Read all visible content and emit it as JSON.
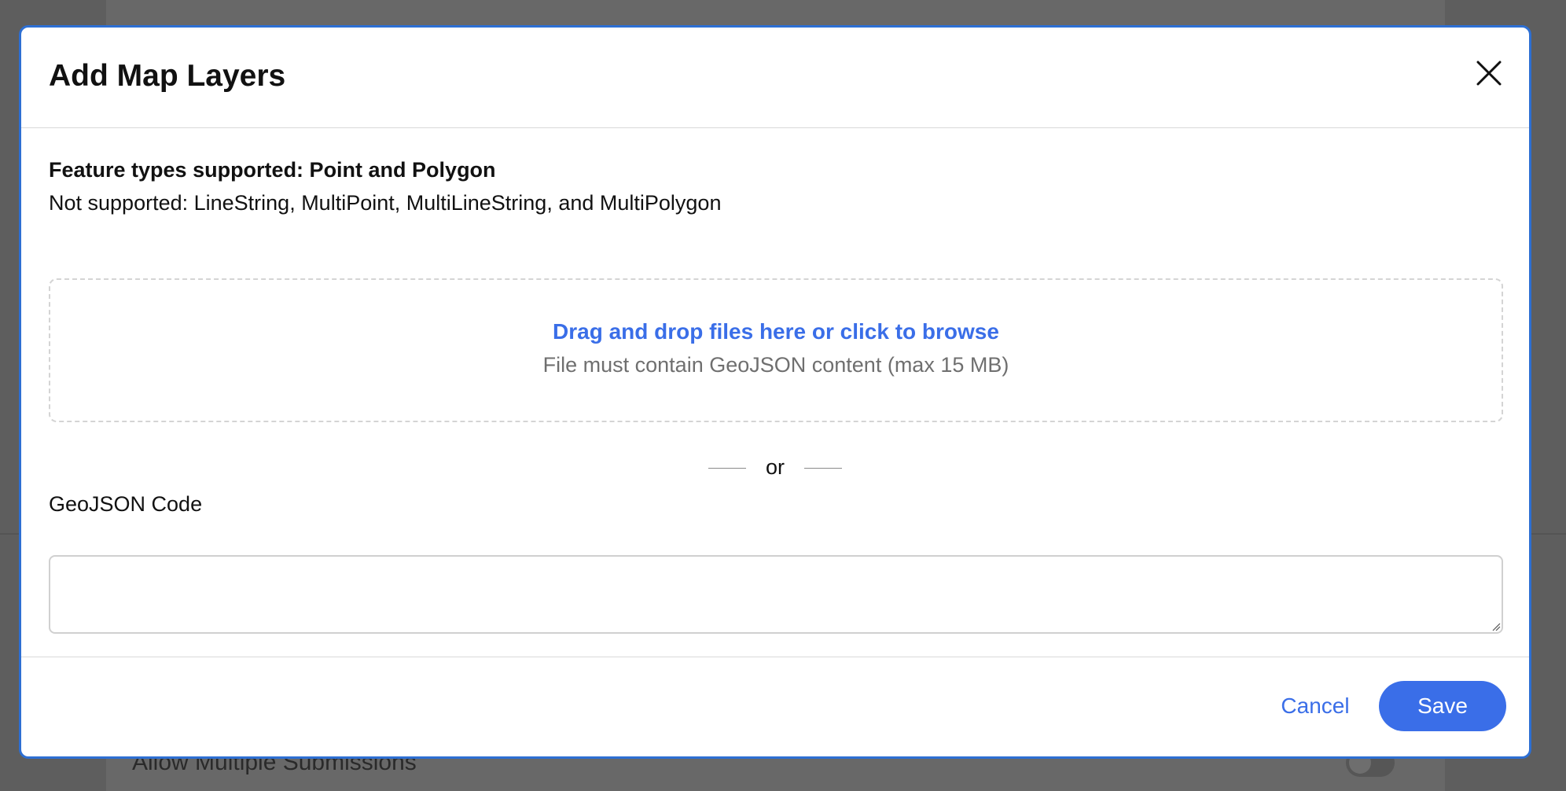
{
  "modal": {
    "title": "Add Map Layers",
    "feature_types_title": "Feature types supported: Point and Polygon",
    "not_supported_text": "Not supported: LineString, MultiPoint, MultiLineString, and MultiPolygon",
    "dropzone": {
      "link_text": "Drag and drop files here or click to browse",
      "hint_text": "File must contain GeoJSON content (max 15 MB)"
    },
    "separator_text": "or",
    "geojson_label": "GeoJSON Code",
    "geojson_value": "",
    "cancel_label": "Cancel",
    "save_label": "Save",
    "close_icon": "close-icon"
  },
  "background": {
    "row_label": "Allow Multiple Submissions"
  },
  "colors": {
    "accent": "#3a6ee8",
    "modal_border": "#2d6fd3",
    "overlay": "#5c5c5c"
  }
}
